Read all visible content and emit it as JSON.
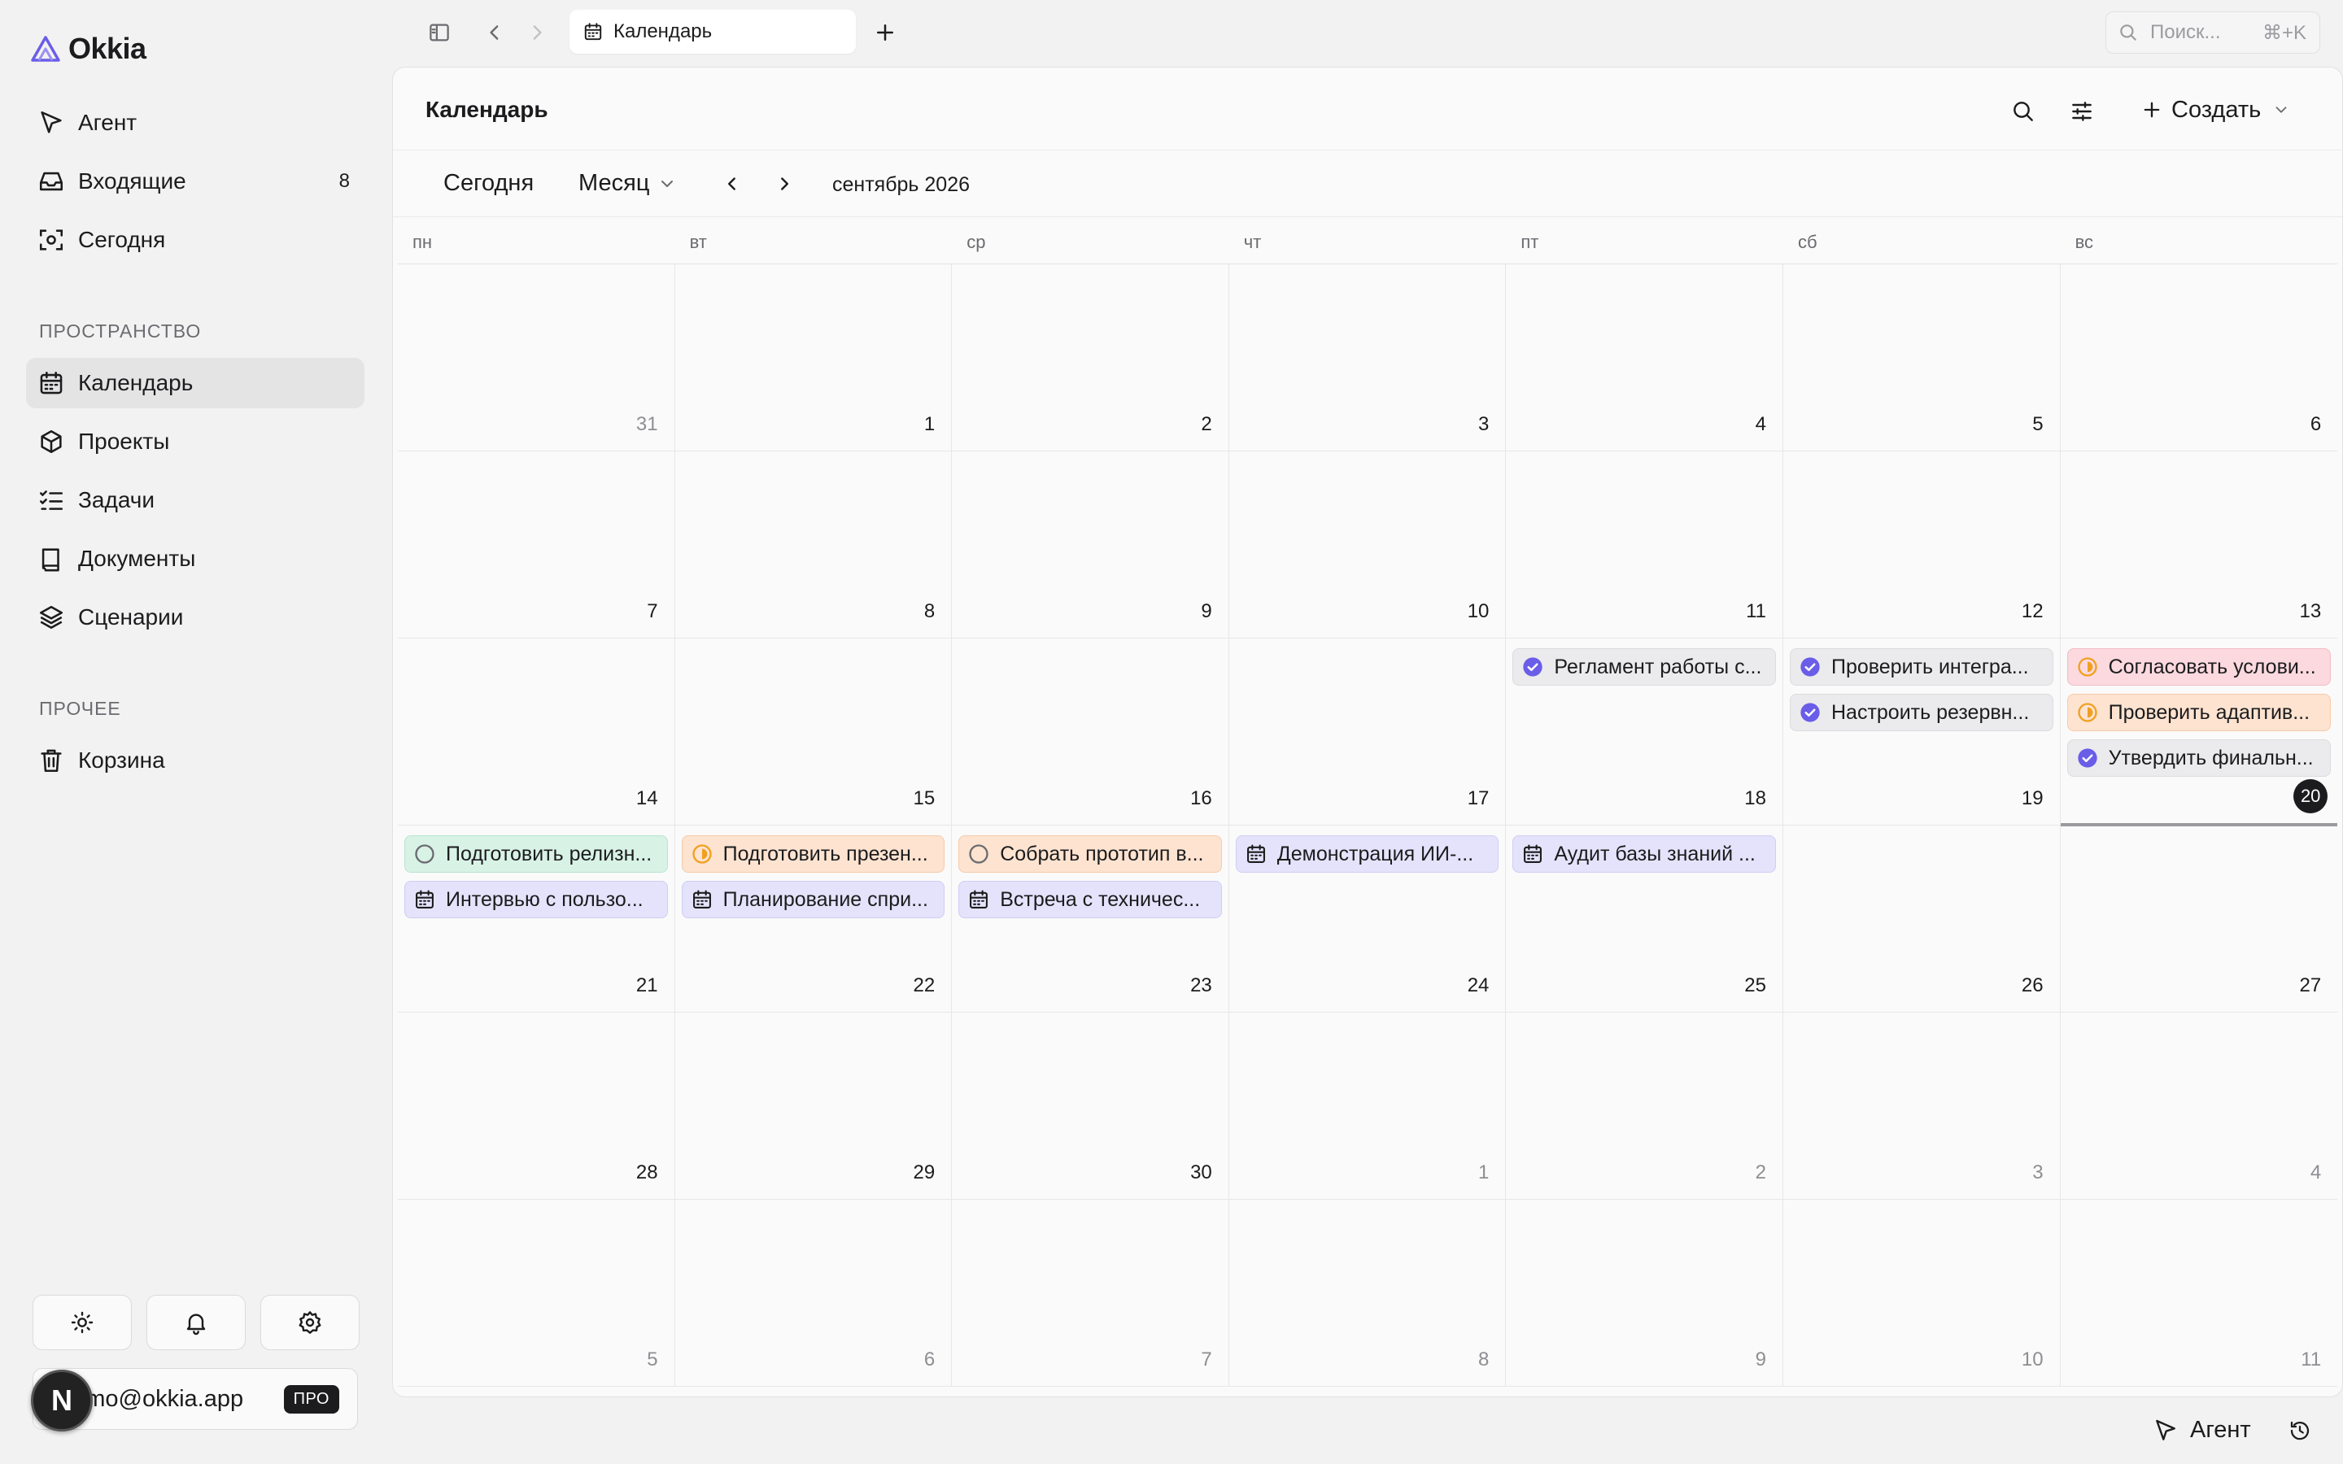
{
  "app": {
    "name": "Okkia"
  },
  "sidebar": {
    "main_items": [
      {
        "label": "Агент",
        "icon": "cursor-icon"
      },
      {
        "label": "Входящие",
        "icon": "inbox-icon",
        "badge": "8"
      },
      {
        "label": "Сегодня",
        "icon": "focus-icon"
      }
    ],
    "workspace_label": "ПРОСТРАНСТВО",
    "workspace_items": [
      {
        "label": "Календарь",
        "icon": "calendar-icon",
        "active": true
      },
      {
        "label": "Проекты",
        "icon": "box-icon"
      },
      {
        "label": "Задачи",
        "icon": "tasks-icon"
      },
      {
        "label": "Документы",
        "icon": "book-icon"
      },
      {
        "label": "Сценарии",
        "icon": "layers-icon"
      }
    ],
    "other_label": "ПРОЧЕЕ",
    "other_items": [
      {
        "label": "Корзина",
        "icon": "trash-icon"
      }
    ],
    "user": {
      "email": "demo@okkia.app",
      "plan": "ПРО",
      "avatar_letter": "N"
    }
  },
  "tabs": [
    {
      "label": "Календарь",
      "icon": "calendar-icon"
    }
  ],
  "search": {
    "placeholder": "Поиск...",
    "shortcut": "⌘+K"
  },
  "page": {
    "title": "Календарь",
    "create_label": "Создать"
  },
  "toolbar": {
    "today_label": "Сегодня",
    "view_label": "Месяц",
    "month_label": "сентябрь 2026"
  },
  "calendar": {
    "weekdays": [
      "пн",
      "вт",
      "ср",
      "чт",
      "пт",
      "сб",
      "вс"
    ],
    "weeks": [
      [
        {
          "day": "31",
          "muted": true
        },
        {
          "day": "1"
        },
        {
          "day": "2"
        },
        {
          "day": "3"
        },
        {
          "day": "4"
        },
        {
          "day": "5"
        },
        {
          "day": "6"
        }
      ],
      [
        {
          "day": "7"
        },
        {
          "day": "8"
        },
        {
          "day": "9"
        },
        {
          "day": "10"
        },
        {
          "day": "11"
        },
        {
          "day": "12"
        },
        {
          "day": "13"
        }
      ],
      [
        {
          "day": "14"
        },
        {
          "day": "15"
        },
        {
          "day": "16"
        },
        {
          "day": "17"
        },
        {
          "day": "18",
          "events": [
            {
              "title": "Регламент работы с...",
              "color": "gray",
              "icon": "check-circle-icon"
            }
          ]
        },
        {
          "day": "19",
          "events": [
            {
              "title": "Проверить интегра...",
              "color": "gray",
              "icon": "check-circle-icon"
            },
            {
              "title": "Настроить резервн...",
              "color": "gray",
              "icon": "check-circle-icon"
            }
          ]
        },
        {
          "day": "20",
          "today": true,
          "events": [
            {
              "title": "Согласовать услови...",
              "color": "pink",
              "icon": "half-circle-icon"
            },
            {
              "title": "Проверить адаптив...",
              "color": "orange",
              "icon": "half-circle-icon"
            },
            {
              "title": "Утвердить финальн...",
              "color": "gray",
              "icon": "check-circle-icon"
            }
          ]
        }
      ],
      [
        {
          "day": "21",
          "events": [
            {
              "title": "Подготовить релизн...",
              "color": "green",
              "icon": "circle-icon"
            },
            {
              "title": "Интервью с пользо...",
              "color": "lavender",
              "icon": "calendar-icon"
            }
          ]
        },
        {
          "day": "22",
          "events": [
            {
              "title": "Подготовить презен...",
              "color": "orange",
              "icon": "half-circle-icon"
            },
            {
              "title": "Планирование спри...",
              "color": "lavender",
              "icon": "calendar-icon"
            }
          ]
        },
        {
          "day": "23",
          "events": [
            {
              "title": "Собрать прототип в...",
              "color": "orange",
              "icon": "circle-icon"
            },
            {
              "title": "Встреча с техничес...",
              "color": "lavender",
              "icon": "calendar-icon"
            }
          ]
        },
        {
          "day": "24",
          "events": [
            {
              "title": "Демонстрация ИИ-...",
              "color": "lavender",
              "icon": "calendar-icon"
            }
          ]
        },
        {
          "day": "25",
          "events": [
            {
              "title": "Аудит базы знаний ...",
              "color": "lavender",
              "icon": "calendar-icon"
            }
          ]
        },
        {
          "day": "26"
        },
        {
          "day": "27"
        }
      ],
      [
        {
          "day": "28"
        },
        {
          "day": "29"
        },
        {
          "day": "30"
        },
        {
          "day": "1",
          "muted": true
        },
        {
          "day": "2",
          "muted": true
        },
        {
          "day": "3",
          "muted": true
        },
        {
          "day": "4",
          "muted": true
        }
      ],
      [
        {
          "day": "5",
          "muted": true
        },
        {
          "day": "6",
          "muted": true
        },
        {
          "day": "7",
          "muted": true
        },
        {
          "day": "8",
          "muted": true
        },
        {
          "day": "9",
          "muted": true
        },
        {
          "day": "10",
          "muted": true
        },
        {
          "day": "11",
          "muted": true
        }
      ]
    ]
  },
  "footer": {
    "agent_label": "Агент"
  },
  "colors": {
    "accent": "#6a5de8",
    "warning": "#f0a020",
    "text": "#1c1c1e",
    "muted": "#8e8e93"
  }
}
